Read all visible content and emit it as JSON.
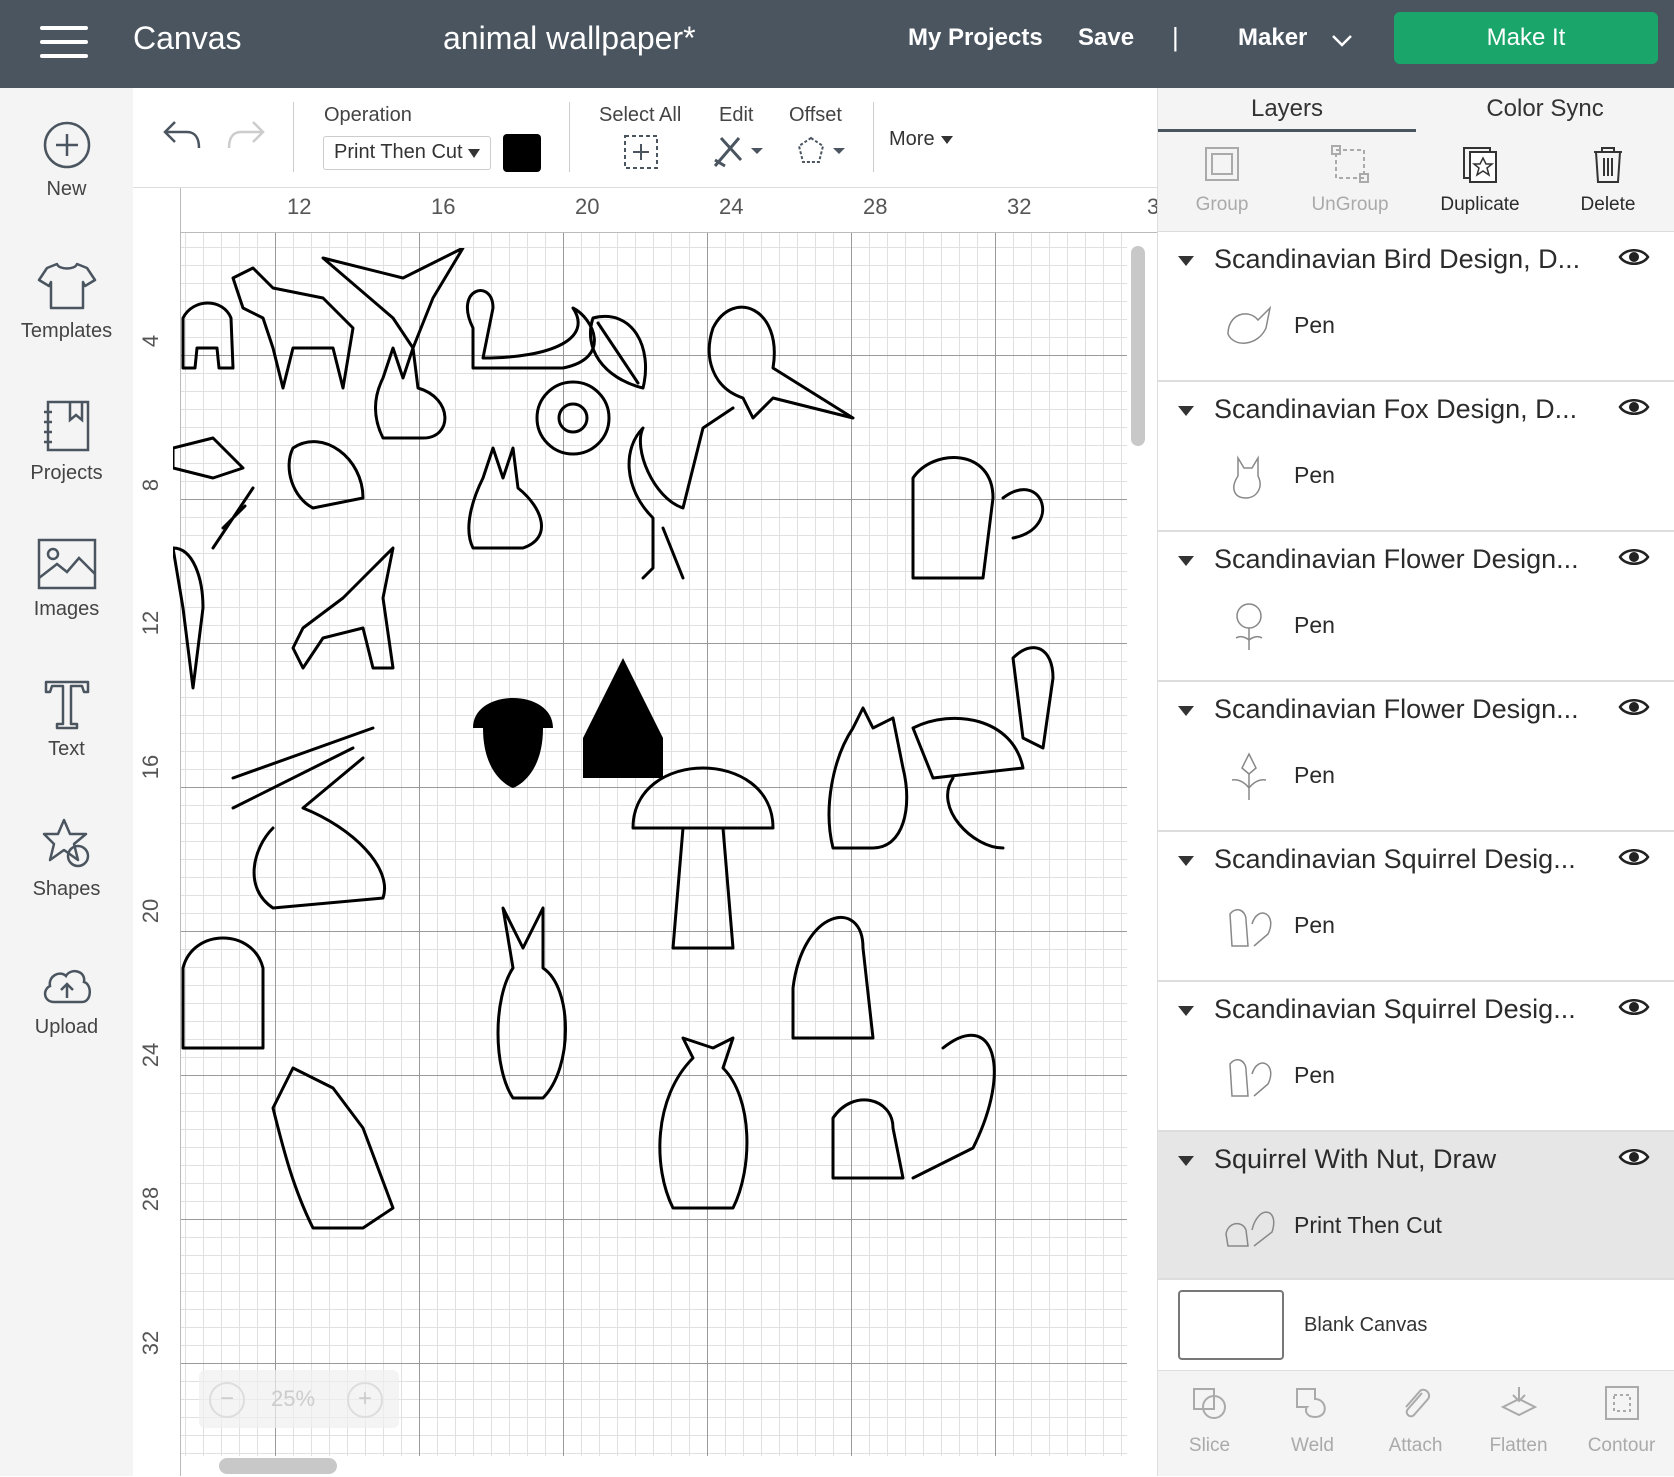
{
  "topbar": {
    "app_title": "Canvas",
    "doc_title": "animal wallpaper*",
    "my_projects": "My Projects",
    "save": "Save",
    "separator": "|",
    "machine": "Maker",
    "make_it": "Make It",
    "bg_color": "#4a5560",
    "make_it_color": "#1aa66a"
  },
  "sidebar": {
    "items": [
      {
        "label": "New",
        "icon": "plus-circle-icon"
      },
      {
        "label": "Templates",
        "icon": "tshirt-icon"
      },
      {
        "label": "Projects",
        "icon": "projects-icon"
      },
      {
        "label": "Images",
        "icon": "image-icon"
      },
      {
        "label": "Text",
        "icon": "text-icon"
      },
      {
        "label": "Shapes",
        "icon": "shapes-icon"
      },
      {
        "label": "Upload",
        "icon": "cloud-upload-icon"
      }
    ]
  },
  "toolbar": {
    "operation_label": "Operation",
    "operation_value": "Print Then Cut",
    "swatch_color": "#000000",
    "select_all": "Select All",
    "edit": "Edit",
    "offset": "Offset",
    "more": "More"
  },
  "canvas": {
    "ruler_top": [
      "12",
      "16",
      "20",
      "24",
      "28",
      "32",
      "3"
    ],
    "ruler_left": [
      "4",
      "8",
      "12",
      "16",
      "20",
      "24",
      "28",
      "32"
    ],
    "zoom": "25%"
  },
  "panel": {
    "tabs": [
      "Layers",
      "Color Sync"
    ],
    "tools": [
      {
        "label": "Group",
        "enabled": false
      },
      {
        "label": "UnGroup",
        "enabled": false
      },
      {
        "label": "Duplicate",
        "enabled": true
      },
      {
        "label": "Delete",
        "enabled": true
      }
    ],
    "layers": [
      {
        "title": "Scandinavian Bird Design, D...",
        "op": "Pen"
      },
      {
        "title": "Scandinavian Fox Design, D...",
        "op": "Pen"
      },
      {
        "title": "Scandinavian Flower Design...",
        "op": "Pen"
      },
      {
        "title": "Scandinavian Flower Design...",
        "op": "Pen"
      },
      {
        "title": "Scandinavian Squirrel Desig...",
        "op": "Pen"
      },
      {
        "title": "Scandinavian Squirrel Desig...",
        "op": "Pen"
      },
      {
        "title": "Squirrel With Nut, Draw",
        "op": "Print Then Cut"
      }
    ],
    "blank_canvas": "Blank Canvas",
    "bottom_tools": [
      "Slice",
      "Weld",
      "Attach",
      "Flatten",
      "Contour"
    ]
  }
}
